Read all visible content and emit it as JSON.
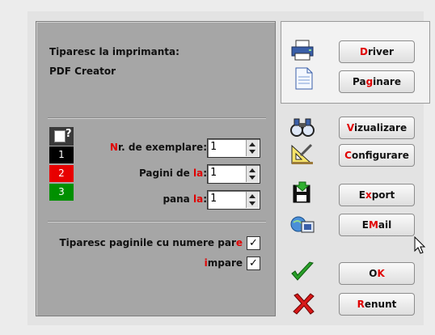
{
  "printer": {
    "heading": "Tiparesc la imprimanta:",
    "name": "PDF Creator"
  },
  "color_legend": {
    "unknown_mark": "?",
    "items": [
      {
        "label": "1",
        "color": "#000000"
      },
      {
        "label": "2",
        "color": "#e80000"
      },
      {
        "label": "3",
        "color": "#009000"
      }
    ]
  },
  "fields": {
    "copies": {
      "label_accent": "N",
      "label_rest": "r. de exemplare:",
      "value": "1"
    },
    "from_page": {
      "label_start": "Pagini de ",
      "label_accent": "la",
      "label_end": ":",
      "value": "1"
    },
    "to_page": {
      "label_start": "pana ",
      "label_accent": "la",
      "label_end": ":",
      "value": "1"
    }
  },
  "parity": {
    "even_label_start": "Tiparesc paginile cu numere par",
    "even_label_accent": "e",
    "even_checked": "✓",
    "odd_label_accent": "i",
    "odd_label_rest": "mpare",
    "odd_checked": "✓"
  },
  "buttons": {
    "driver": {
      "accent": "D",
      "rest": "river"
    },
    "paginare": {
      "pre": "Pa",
      "accent": "g",
      "post": "inare"
    },
    "vizualizare": {
      "accent": "V",
      "rest": "izualizare"
    },
    "configurare": {
      "accent": "C",
      "rest": "onfigurare"
    },
    "export": {
      "pre": "E",
      "accent": "x",
      "post": "port"
    },
    "email": {
      "pre": "E",
      "accent": "M",
      "post": "ail"
    },
    "ok": {
      "pre": "O",
      "accent": "K"
    },
    "renunt": {
      "accent": "R",
      "rest": "enunt"
    }
  },
  "icons": {
    "driver": "printer-icon",
    "paginare": "document-icon",
    "vizualizare": "binoculars-icon",
    "configurare": "ruler-triangle-icon",
    "export": "floppy-export-icon",
    "email": "globe-email-icon",
    "ok": "checkmark-icon",
    "renunt": "x-cross-icon"
  }
}
